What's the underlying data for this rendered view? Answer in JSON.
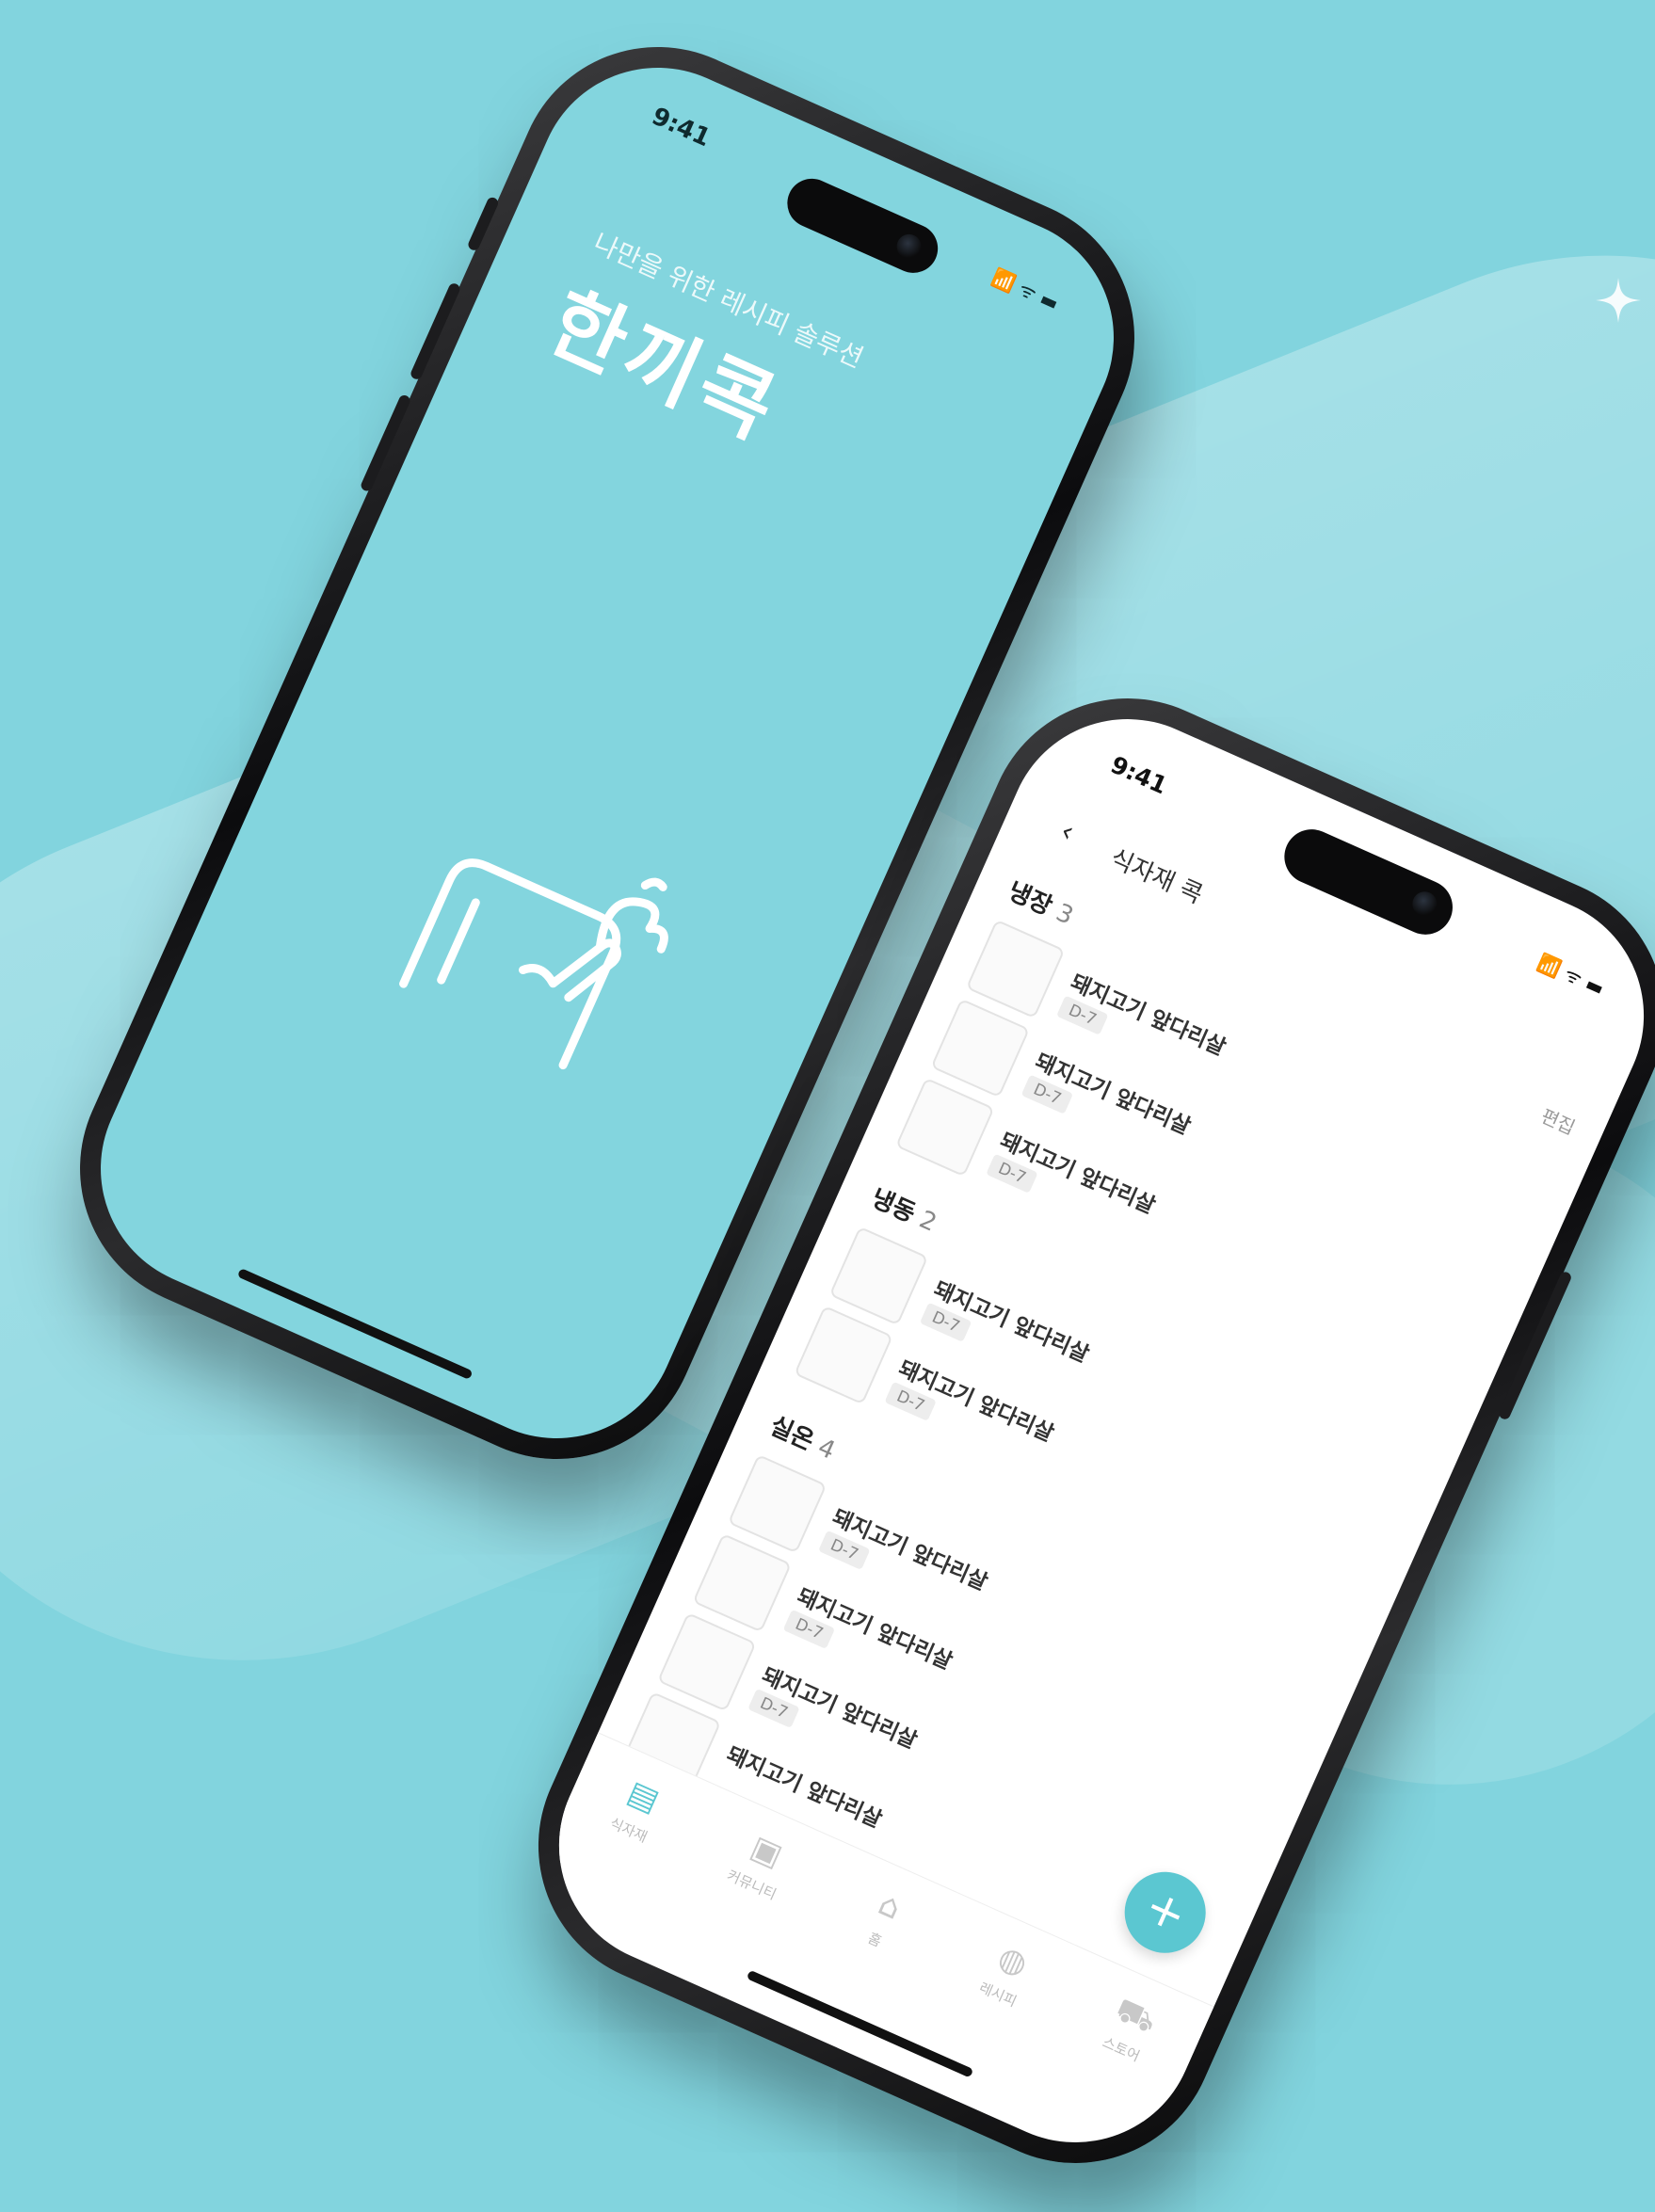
{
  "colors": {
    "background": "#82d4de",
    "accent": "#5bc7d1",
    "splash_bg": "#83d5de"
  },
  "phone1": {
    "time": "9:41",
    "status_icons": "📶 ᯤ ▬",
    "subtitle": "나만을 위한 레시피 솔루션",
    "app_title": "한끼콕",
    "logo_icon": "fridge-pointer-logo-icon"
  },
  "phone2": {
    "time": "9:41",
    "status_icons": "📶 ᯤ ▬",
    "header": {
      "back_icon": "‹",
      "title": "식자재 콕"
    },
    "edit_label": "편집",
    "sections": [
      {
        "name": "냉장",
        "count": "3",
        "items": [
          {
            "name": "돼지고기 앞다리살",
            "badge": "D-7"
          },
          {
            "name": "돼지고기 앞다리살",
            "badge": "D-7"
          },
          {
            "name": "돼지고기 앞다리살",
            "badge": "D-7"
          }
        ]
      },
      {
        "name": "냉동",
        "count": "2",
        "items": [
          {
            "name": "돼지고기 앞다리살",
            "badge": "D-7"
          },
          {
            "name": "돼지고기 앞다리살",
            "badge": "D-7"
          }
        ]
      },
      {
        "name": "실온",
        "count": "4",
        "items": [
          {
            "name": "돼지고기 앞다리살",
            "badge": "D-7"
          },
          {
            "name": "돼지고기 앞다리살",
            "badge": "D-7"
          },
          {
            "name": "돼지고기 앞다리살",
            "badge": "D-7"
          },
          {
            "name": "돼지고기 앞다리살",
            "badge": ""
          }
        ]
      }
    ],
    "fab_label": "+",
    "tabs": [
      {
        "icon": "▤",
        "label": "식자재",
        "active": true
      },
      {
        "icon": "▣",
        "label": "커뮤니티",
        "active": false
      },
      {
        "icon": "⌂",
        "label": "홈",
        "active": false
      },
      {
        "icon": "◍",
        "label": "레시피",
        "active": false
      },
      {
        "icon": "⛟",
        "label": "스토어",
        "active": false
      }
    ]
  }
}
